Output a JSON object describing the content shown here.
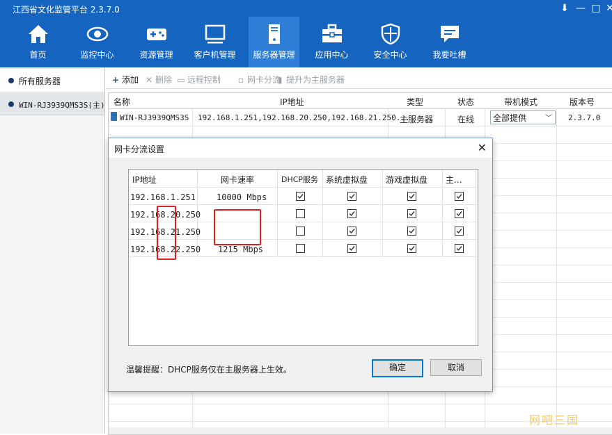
{
  "window": {
    "title": "江西省文化监管平台 2.3.7.0",
    "controls": {
      "down": "⬇",
      "minimize": "—",
      "maximize": "□",
      "close": "✕"
    }
  },
  "nav": {
    "tabs": [
      {
        "label": "首页",
        "icon": "home-icon"
      },
      {
        "label": "监控中心",
        "icon": "eye-icon"
      },
      {
        "label": "资源管理",
        "icon": "gamepad-icon"
      },
      {
        "label": "客户机管理",
        "icon": "monitor-icon"
      },
      {
        "label": "服务器管理",
        "icon": "server-icon",
        "active": true
      },
      {
        "label": "应用中心",
        "icon": "toolbox-icon"
      },
      {
        "label": "安全中心",
        "icon": "shield-icon"
      },
      {
        "label": "我要吐槽",
        "icon": "feedback-icon"
      }
    ]
  },
  "sidebar": {
    "items": [
      {
        "label": "所有服务器"
      },
      {
        "label": "WIN-RJ3939QMS3S(主)"
      }
    ]
  },
  "toolbar": {
    "add": "添加",
    "delete": "删除",
    "remote": "远程控制",
    "split": "网卡分流",
    "promote": "提升为主服务器"
  },
  "table": {
    "headers": [
      "名称",
      "IP地址",
      "类型",
      "状态",
      "带机模式",
      "版本号"
    ],
    "row": {
      "name": "WIN-RJ3939QMS3S",
      "ip": "192.168.1.251,192.168.20.250,192.168.21.250...",
      "type": "主服务器",
      "status": "在线",
      "mode": "全部提供",
      "version": "2.3.7.0"
    }
  },
  "dialog": {
    "title": "网卡分流设置",
    "close": "✕",
    "headers": [
      "IP地址",
      "网卡速率",
      "DHCP服务",
      "系统虚拟盘",
      "游戏虚拟盘",
      "主..."
    ],
    "rows": [
      {
        "ip": "192.168.1.251",
        "rate": "10000 Mbps",
        "dhcp": true,
        "sys": true,
        "game": true,
        "main": true
      },
      {
        "ip": "192.168.20.250",
        "rate": "",
        "dhcp": false,
        "sys": true,
        "game": true,
        "main": true
      },
      {
        "ip": "192.168.21.250",
        "rate": "",
        "dhcp": false,
        "sys": true,
        "game": true,
        "main": true
      },
      {
        "ip": "192.168.22.250",
        "rate": "1215 Mbps",
        "dhcp": false,
        "sys": true,
        "game": true,
        "main": true
      }
    ],
    "tip": "温馨提醒：DHCP服务仅在主服务器上生效。",
    "ok": "确定",
    "cancel": "取消"
  },
  "watermark": "网吧三国",
  "colors": {
    "header": "#1565c0",
    "active_tab": "#2f7fd8",
    "highlight": "#e02020"
  }
}
